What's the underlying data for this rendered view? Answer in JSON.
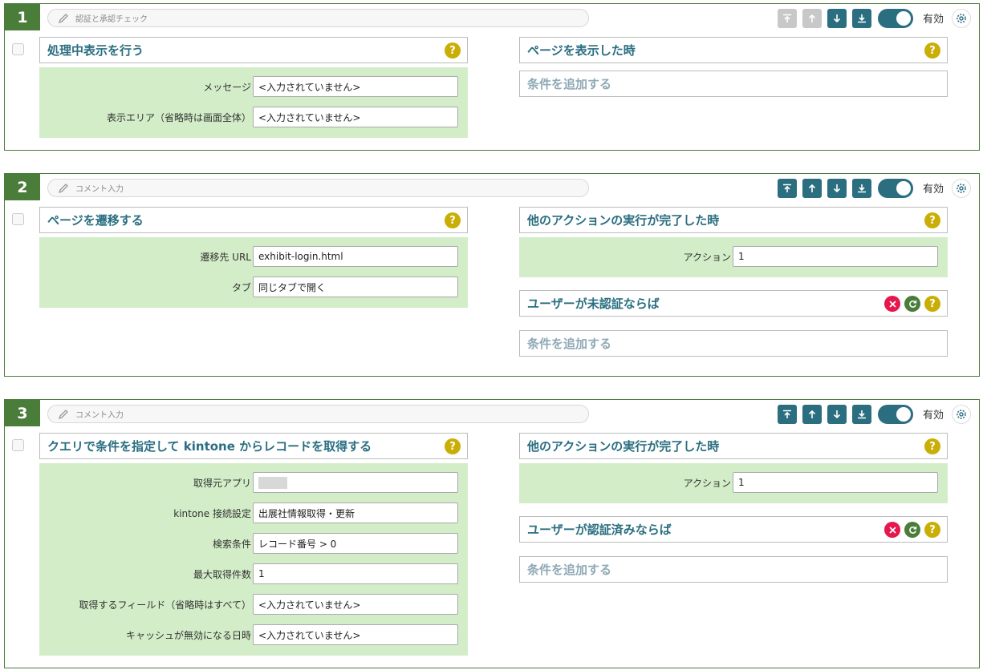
{
  "blocks": [
    {
      "number": "1",
      "comment": "認証と承認チェック",
      "enabled_label": "有効",
      "action": {
        "title": "処理中表示を行う"
      },
      "params": [
        {
          "label": "メッセージ",
          "value": "<入力されていません>"
        },
        {
          "label": "表示エリア（省略時は画面全体）",
          "value": "<入力されていません>"
        }
      ],
      "trigger": {
        "title": "ページを表示した時"
      },
      "add_condition": "条件を追加する"
    },
    {
      "number": "2",
      "comment": "コメント入力",
      "enabled_label": "有効",
      "action": {
        "title": "ページを遷移する"
      },
      "params": [
        {
          "label": "遷移先 URL",
          "value": "exhibit-login.html"
        },
        {
          "label": "タブ",
          "value": "同じタブで開く"
        }
      ],
      "trigger": {
        "title": "他のアクションの実行が完了した時"
      },
      "trigger_params": [
        {
          "label": "アクション",
          "value": "1"
        }
      ],
      "condition": {
        "title": "ユーザーが未認証ならば"
      },
      "add_condition": "条件を追加する"
    },
    {
      "number": "3",
      "comment": "コメント入力",
      "enabled_label": "有効",
      "action": {
        "title": "クエリで条件を指定して kintone からレコードを取得する"
      },
      "params": [
        {
          "label": "取得元アプリ",
          "value": ""
        },
        {
          "label": "kintone 接続設定",
          "value": "出展社情報取得・更新"
        },
        {
          "label": "検索条件",
          "value": "レコード番号 > 0"
        },
        {
          "label": "最大取得件数",
          "value": "1"
        },
        {
          "label": "取得するフィールド（省略時はすべて）",
          "value": "<入力されていません>"
        },
        {
          "label": "キャッシュが無効になる日時",
          "value": "<入力されていません>"
        }
      ],
      "trigger": {
        "title": "他のアクションの実行が完了した時"
      },
      "trigger_params": [
        {
          "label": "アクション",
          "value": "1"
        }
      ],
      "condition": {
        "title": "ユーザーが認証済みならば"
      },
      "add_condition": "条件を追加する"
    }
  ],
  "help_glyph": "?",
  "colors": {
    "accent": "#2a6e80",
    "green": "#4a7c3a",
    "param_bg": "#d2edc7",
    "help": "#c9ae05",
    "remove": "#e5174d"
  }
}
